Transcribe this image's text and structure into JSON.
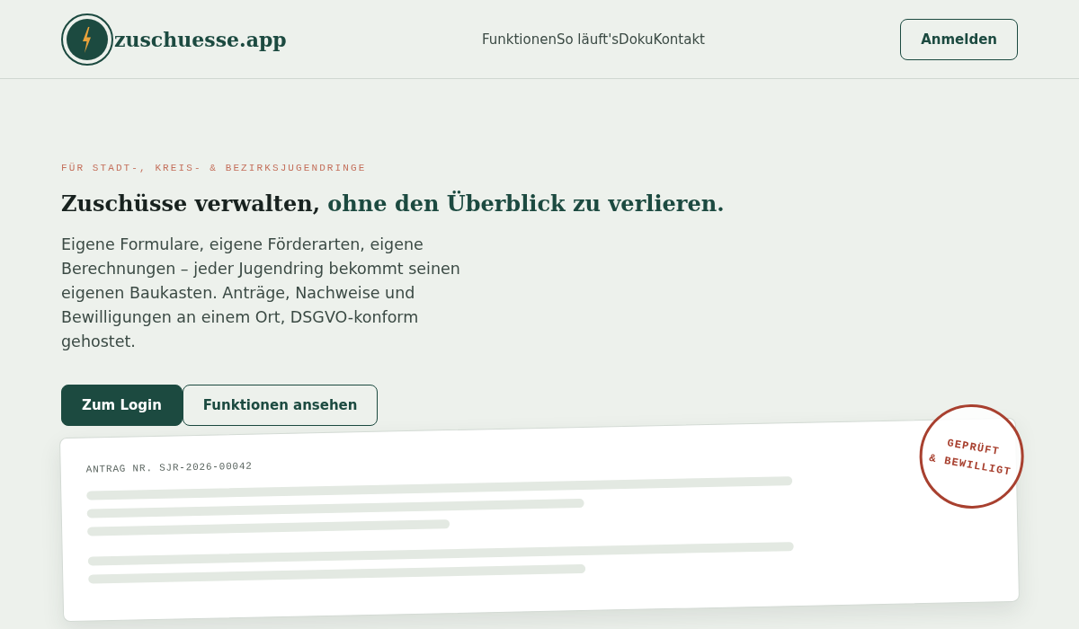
{
  "header": {
    "logo": {
      "text": "zuschuesse.app"
    },
    "nav": [
      {
        "label": "Funktionen"
      },
      {
        "label": "So läuft's"
      },
      {
        "label": "Doku"
      },
      {
        "label": "Kontakt"
      }
    ],
    "login_button": {
      "label": "Anmelden"
    }
  },
  "hero": {
    "eyebrow": "FÜR STADT-, KREIS- & BEZIRKSJUGENDRINGE",
    "heading": {
      "text": "Zuschüsse verwalten,",
      "accent": "ohne den Überblick zu verlieren."
    },
    "description": "Eigene Formulare, eigene Förderarten, eigene Berechnungen – jeder Jugendring bekommt seinen eigenen Baukasten. Anträge, Nachweise und Bewilligungen an einem Ort, DSGVO-konform gehostet.",
    "actions": [
      {
        "label": "Zum Login",
        "kind": "primary"
      },
      {
        "label": "Funktionen ansehen",
        "kind": "secondary"
      }
    ]
  },
  "preview_card": {
    "label": "ANTRAG NR. SJR-2026-00042",
    "stamp": {
      "lines": [
        "GEPRÜFT",
        "& BEWILLIGT"
      ]
    }
  }
}
